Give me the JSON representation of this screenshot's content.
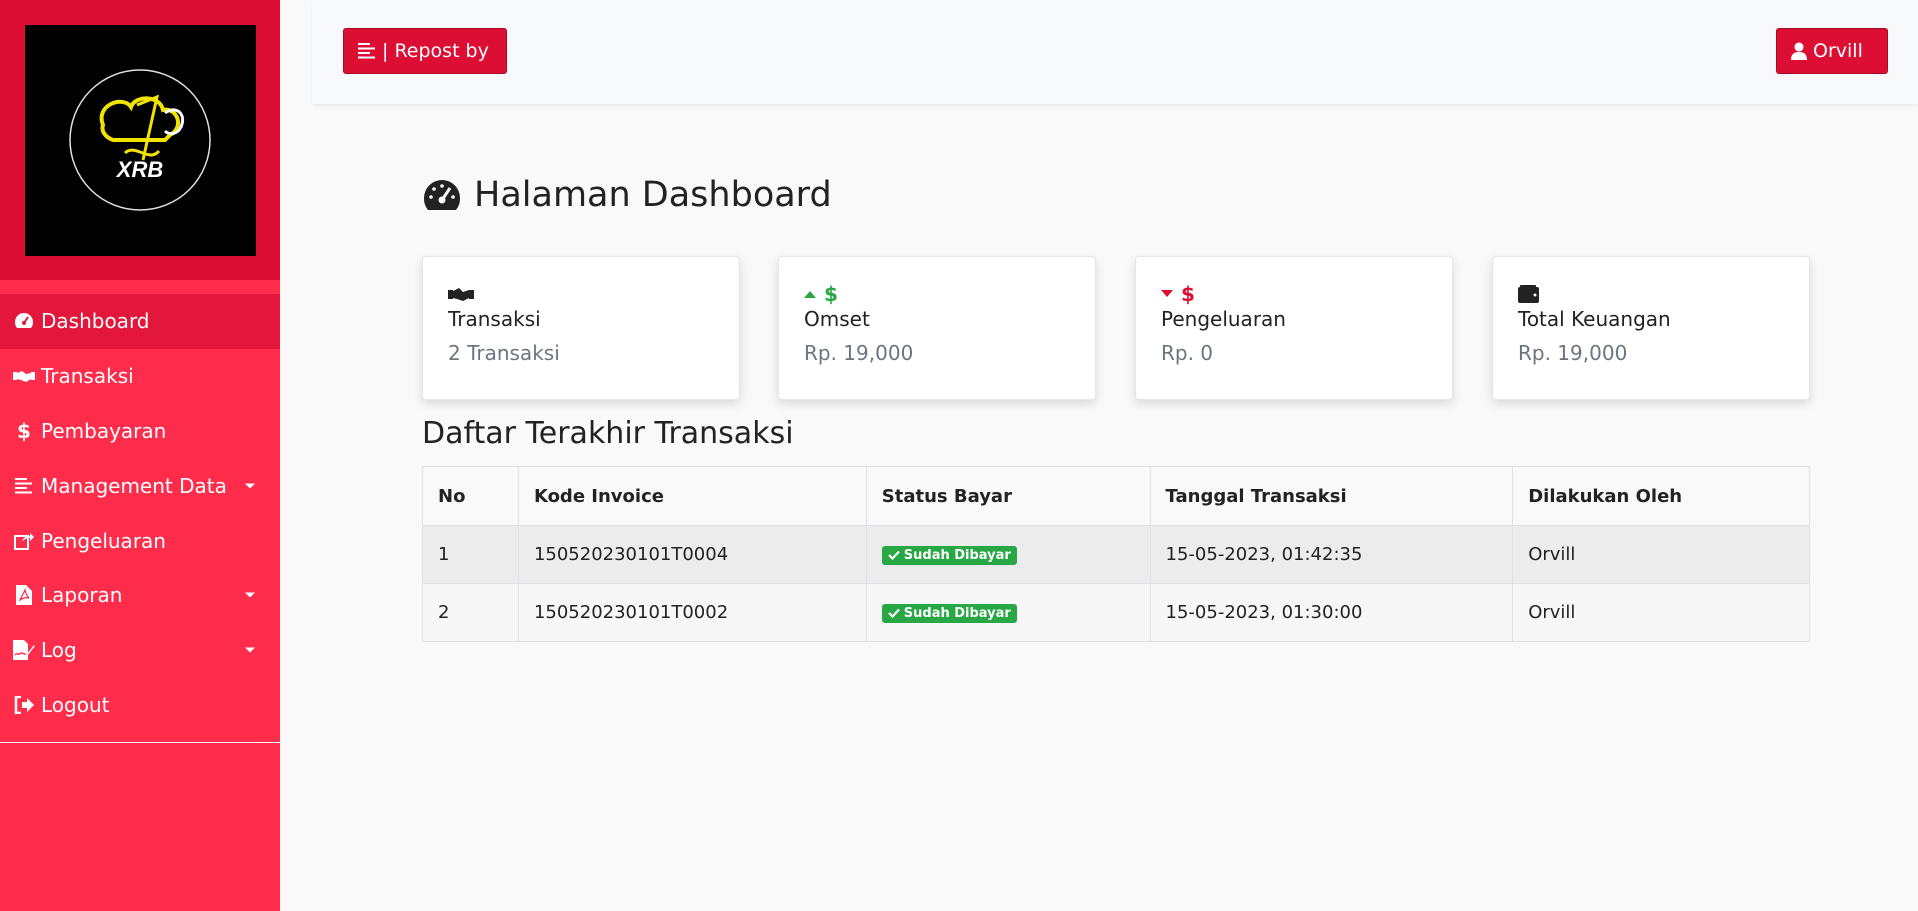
{
  "sidebar": {
    "logo_text": "XRB",
    "items": [
      {
        "label": "Dashboard",
        "icon": "gauge-icon",
        "active": true
      },
      {
        "label": "Transaksi",
        "icon": "handshake-icon"
      },
      {
        "label": "Pembayaran",
        "icon": "dollar-icon"
      },
      {
        "label": "Management Data",
        "icon": "align-left-icon",
        "dropdown": true
      },
      {
        "label": "Pengeluaran",
        "icon": "share-square-icon"
      },
      {
        "label": "Laporan",
        "icon": "file-pdf-icon",
        "dropdown": true
      },
      {
        "label": "Log",
        "icon": "file-signature-icon",
        "dropdown": true
      },
      {
        "label": "Logout",
        "icon": "sign-out-icon"
      }
    ]
  },
  "topbar": {
    "repost_label": "| Repost by",
    "user_label": "Orvill"
  },
  "main": {
    "title": "Halaman Dashboard",
    "cards": [
      {
        "label": "Transaksi",
        "value": "2 Transaksi",
        "icon": "handshake-icon"
      },
      {
        "label": "Omset",
        "value": "Rp. 19,000",
        "icon": "caret-up-dollar-icon"
      },
      {
        "label": "Pengeluaran",
        "value": "Rp. 0",
        "icon": "caret-down-dollar-icon"
      },
      {
        "label": "Total Keuangan",
        "value": "Rp. 19,000",
        "icon": "wallet-icon"
      }
    ],
    "table_title": "Daftar Terakhir Transaksi",
    "table": {
      "headers": [
        "No",
        "Kode Invoice",
        "Status Bayar",
        "Tanggal Transaksi",
        "Dilakukan Oleh"
      ],
      "rows": [
        {
          "no": "1",
          "invoice": "150520230101T0004",
          "status": "Sudah Dibayar",
          "date": "15-05-2023, 01:42:35",
          "by": "Orvill"
        },
        {
          "no": "2",
          "invoice": "150520230101T0002",
          "status": "Sudah Dibayar",
          "date": "15-05-2023, 01:30:00",
          "by": "Orvill"
        }
      ]
    }
  },
  "colors": {
    "sidebar_bg": "#ff2d4b",
    "sidebar_active": "#e3173b",
    "brand_red": "#dc0e33",
    "success_green": "#28a745"
  }
}
